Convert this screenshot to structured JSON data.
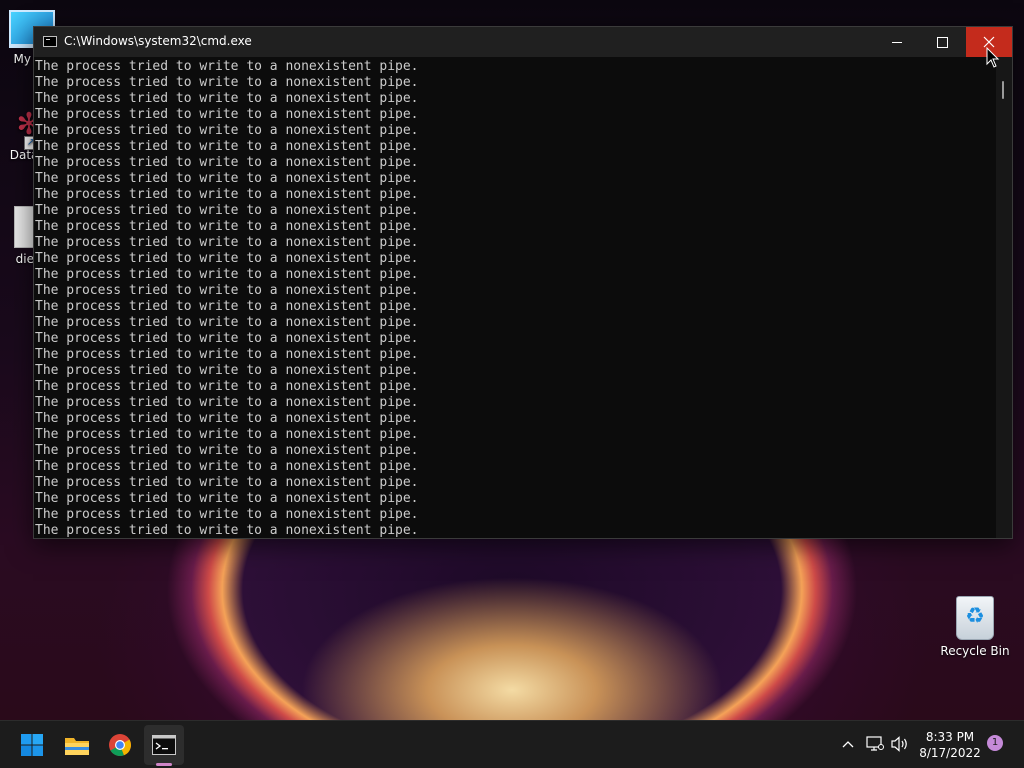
{
  "desktop": {
    "icons": [
      {
        "label": "My Co"
      },
      {
        "label": "DataW"
      },
      {
        "label": "die.c"
      },
      {
        "label": "Recycle Bin"
      }
    ]
  },
  "window": {
    "title": "C:\\Windows\\system32\\cmd.exe",
    "lines": [
      "The process tried to write to a nonexistent pipe.",
      "The process tried to write to a nonexistent pipe.",
      "The process tried to write to a nonexistent pipe.",
      "The process tried to write to a nonexistent pipe.",
      "The process tried to write to a nonexistent pipe.",
      "The process tried to write to a nonexistent pipe.",
      "The process tried to write to a nonexistent pipe.",
      "The process tried to write to a nonexistent pipe.",
      "The process tried to write to a nonexistent pipe.",
      "The process tried to write to a nonexistent pipe.",
      "The process tried to write to a nonexistent pipe.",
      "The process tried to write to a nonexistent pipe.",
      "The process tried to write to a nonexistent pipe.",
      "The process tried to write to a nonexistent pipe.",
      "The process tried to write to a nonexistent pipe.",
      "The process tried to write to a nonexistent pipe.",
      "The process tried to write to a nonexistent pipe.",
      "The process tried to write to a nonexistent pipe.",
      "The process tried to write to a nonexistent pipe.",
      "The process tried to write to a nonexistent pipe.",
      "The process tried to write to a nonexistent pipe.",
      "The process tried to write to a nonexistent pipe.",
      "The process tried to write to a nonexistent pipe.",
      "The process tried to write to a nonexistent pipe.",
      "The process tried to write to a nonexistent pipe.",
      "The process tried to write to a nonexistent pipe.",
      "The process tried to write to a nonexistent pipe.",
      "The process tried to write to a nonexistent pipe.",
      "The process tried to write to a nonexistent pipe.",
      "The process tried to write to a nonexistent pipe."
    ],
    "text_color": "#cccccc",
    "background_color": "#0c0c0c"
  },
  "taskbar": {
    "apps": [
      "start-icon",
      "file-explorer-icon",
      "chrome-icon",
      "command-prompt-icon"
    ],
    "clock": {
      "time": "8:33 PM",
      "date": "8/17/2022"
    },
    "notification_count": "1",
    "accent_color": "#d086c8"
  },
  "colors": {
    "close_button": "#c42b1c",
    "titlebar": "#202020",
    "taskbar": "#1c1c1c"
  }
}
